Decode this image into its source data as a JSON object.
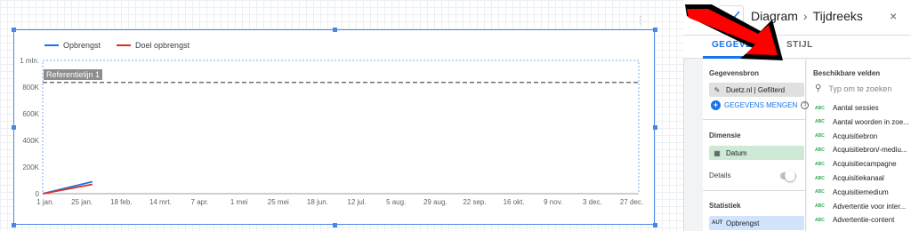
{
  "chart": {
    "legend": [
      {
        "label": "Opbrengst",
        "color": "#1a73e8"
      },
      {
        "label": "Doel opbrengst",
        "color": "#d93025"
      }
    ],
    "reference_line_label": "Referentielijn 1"
  },
  "chart_data": {
    "type": "line",
    "x_tick_labels": [
      "1 jan.",
      "25 jan.",
      "18 feb.",
      "14 mrt.",
      "7 apr.",
      "1 mei",
      "25 mei",
      "18 jun.",
      "12 jul.",
      "5 aug.",
      "29 aug.",
      "22 sep.",
      "16 okt.",
      "9 nov.",
      "3 dec.",
      "27 dec."
    ],
    "y_tick_labels": [
      "0",
      "200K",
      "400K",
      "600K",
      "800K",
      "1 mln."
    ],
    "ylim": [
      0,
      1000000
    ],
    "xlim_days": [
      0,
      360
    ],
    "series": [
      {
        "name": "Opbrengst",
        "color": "#1a73e8",
        "x_days": [
          0,
          30
        ],
        "values": [
          0,
          90000
        ]
      },
      {
        "name": "Doel opbrengst",
        "color": "#d93025",
        "x_days": [
          0,
          30
        ],
        "values": [
          0,
          70000
        ]
      }
    ],
    "reference_line": {
      "label": "Referentielijn 1",
      "value": 835000,
      "color": "#707070"
    },
    "grid": true,
    "legend_position": "top-left"
  },
  "panel": {
    "breadcrumb_root": "Diagram",
    "breadcrumb_sep": "›",
    "breadcrumb_current": "Tijdreeks",
    "tab_data": "GEGEVENS",
    "tab_style": "STIJL",
    "data_source_title": "Gegevensbron",
    "data_source_name": "Duetz.nl | Gefilterd",
    "blend_label": "GEGEVENS MENGEN",
    "dimension_title": "Dimensie",
    "dimension_value": "Datum",
    "details_label": "Details",
    "metrics_title": "Statistiek",
    "metric_value": "Opbrengst",
    "metric_prefix": "AUT",
    "fields_title": "Beschikbare velden",
    "search_placeholder": "Typ om te zoeken",
    "field_type": "ABC",
    "fields": [
      "Aantal sessies",
      "Aantal woorden in zoe...",
      "Acquisitiebron",
      "Acquisitiebron/-mediu...",
      "Acquisitiecampagne",
      "Acquisitiekanaal",
      "Acquisitiemedium",
      "Advertentie voor inter...",
      "Advertentie-content"
    ]
  }
}
